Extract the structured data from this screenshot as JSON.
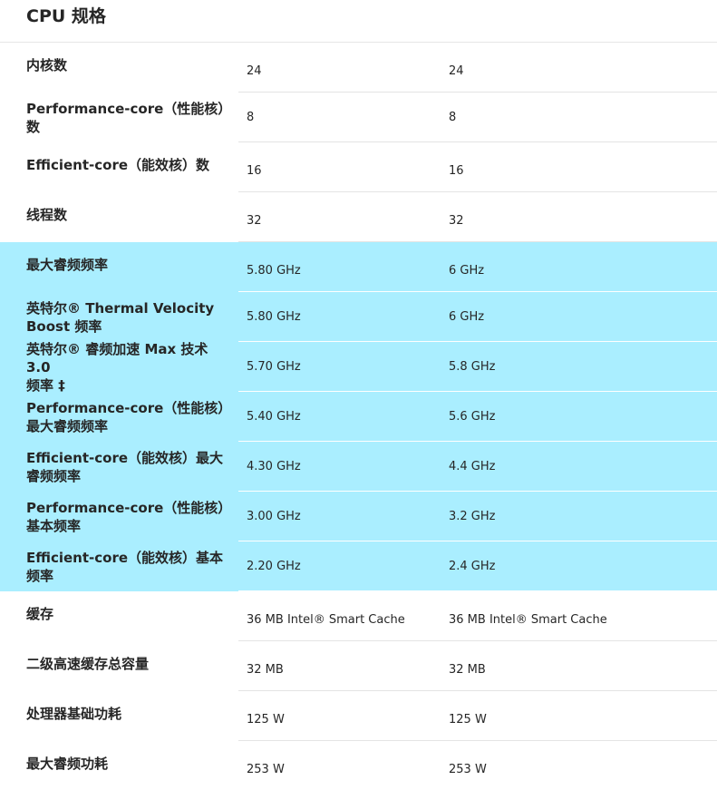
{
  "section": {
    "title": "CPU 规格"
  },
  "rows": [
    {
      "label": "内核数",
      "a": "24",
      "b": "24",
      "highlight": false
    },
    {
      "label": "Performance-core（性能核）\n数",
      "a": "8",
      "b": "8",
      "highlight": false
    },
    {
      "label": "Efficient-core（能效核）数",
      "a": "16",
      "b": "16",
      "highlight": false
    },
    {
      "label": "线程数",
      "a": "32",
      "b": "32",
      "highlight": false
    },
    {
      "label": "最大睿频频率",
      "a": "5.80 GHz",
      "b": "6 GHz",
      "highlight": true
    },
    {
      "label": "英特尔® Thermal Velocity\nBoost 频率",
      "a": "5.80 GHz",
      "b": "6 GHz",
      "highlight": true
    },
    {
      "label": "英特尔® 睿频加速 Max 技术 3.0\n频率 ‡",
      "a": "5.70 GHz",
      "b": "5.8 GHz",
      "highlight": true
    },
    {
      "label": "Performance-core（性能核）\n最大睿频频率",
      "a": "5.40 GHz",
      "b": "5.6 GHz",
      "highlight": true
    },
    {
      "label": "Efficient-core（能效核）最大\n睿频频率",
      "a": "4.30 GHz",
      "b": "4.4 GHz",
      "highlight": true
    },
    {
      "label": "Performance-core（性能核）\n基本频率",
      "a": "3.00 GHz",
      "b": "3.2 GHz",
      "highlight": true
    },
    {
      "label": "Efficient-core（能效核）基本\n频率",
      "a": "2.20 GHz",
      "b": "2.4 GHz",
      "highlight": true
    },
    {
      "label": "缓存",
      "a": "36 MB Intel® Smart Cache",
      "b": "36 MB Intel® Smart Cache",
      "highlight": false
    },
    {
      "label": "二级高速缓存总容量",
      "a": "32 MB",
      "b": "32 MB",
      "highlight": false
    },
    {
      "label": "处理器基础功耗",
      "a": "125 W",
      "b": "125 W",
      "highlight": false
    },
    {
      "label": "最大睿频功耗",
      "a": "253 W",
      "b": "253 W",
      "highlight": false
    }
  ],
  "colors": {
    "highlight_bg": "#aaeeff",
    "text": "#262626",
    "divider": "#e4e4e4"
  }
}
